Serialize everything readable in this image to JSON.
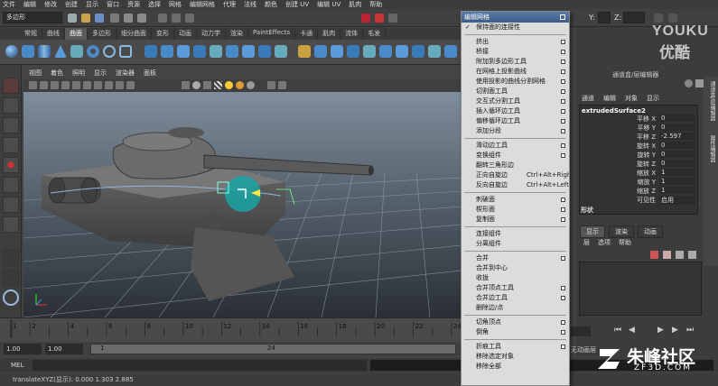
{
  "menubar": [
    "文件",
    "编辑",
    "修改",
    "创建",
    "显示",
    "窗口",
    "资源",
    "选择",
    "网格",
    "编辑网格",
    "代理",
    "法线",
    "颜色",
    "创建 UV",
    "编辑 UV",
    "肌肉",
    "帮助"
  ],
  "status": {
    "mode": "多边形",
    "x_label": "X:",
    "y_label": "Y:",
    "z_label": "Z:"
  },
  "shelf_tabs": [
    "常规",
    "曲线",
    "曲面",
    "多边形",
    "细分曲面",
    "变形",
    "动画",
    "动力学",
    "渲染",
    "PaintEffects",
    "卡通",
    "肌肉",
    "流体",
    "毛发"
  ],
  "shelf_active": "曲面",
  "viewport_menu": [
    "视图",
    "着色",
    "照明",
    "显示",
    "渲染器",
    "面板"
  ],
  "menu": {
    "title": "编辑网格",
    "items": [
      {
        "label": "保持面的连接性",
        "check": "✓",
        "box": false,
        "shortcut": ""
      },
      {
        "sep": true
      },
      {
        "label": "挤出",
        "box": true
      },
      {
        "label": "桥接",
        "box": true
      },
      {
        "label": "附加到多边形工具",
        "box": true
      },
      {
        "label": "在网格上投影曲线",
        "box": true
      },
      {
        "label": "使用投影的曲线分割网格",
        "box": true
      },
      {
        "label": "切割面工具",
        "box": true
      },
      {
        "label": "交互式分割工具",
        "box": true
      },
      {
        "label": "插入循环边工具",
        "box": true
      },
      {
        "label": "偏移循环边工具",
        "box": true
      },
      {
        "label": "添加分段",
        "box": true
      },
      {
        "sep": true
      },
      {
        "label": "滑动边工具",
        "box": true
      },
      {
        "label": "变换组件",
        "box": true
      },
      {
        "label": "翻转三角形边",
        "box": false
      },
      {
        "label": "正向自旋边",
        "box": false,
        "shortcut": "Ctrl+Alt+Right"
      },
      {
        "label": "反向自旋边",
        "box": false,
        "shortcut": "Ctrl+Alt+Left"
      },
      {
        "sep": true
      },
      {
        "label": "刺破面",
        "box": true
      },
      {
        "label": "楔形面",
        "box": true
      },
      {
        "label": "复制面",
        "box": true
      },
      {
        "sep": true
      },
      {
        "label": "连接组件",
        "box": false
      },
      {
        "label": "分离组件",
        "box": false
      },
      {
        "sep": true
      },
      {
        "label": "合并",
        "box": true
      },
      {
        "label": "合并到中心",
        "box": false
      },
      {
        "label": "收拢",
        "box": false
      },
      {
        "label": "合并顶点工具",
        "box": true
      },
      {
        "label": "合并边工具",
        "box": true
      },
      {
        "label": "删除边/点",
        "box": false
      },
      {
        "sep": true
      },
      {
        "label": "切角顶点",
        "box": true
      },
      {
        "label": "倒角",
        "box": true
      },
      {
        "sep": true
      },
      {
        "label": "折痕工具",
        "box": true
      },
      {
        "label": "移除选定对象",
        "box": false
      },
      {
        "label": "移除全部",
        "box": false
      }
    ]
  },
  "channel_box": {
    "header": "通道盒/层编辑器",
    "tabs": [
      "通道",
      "编辑",
      "对象",
      "显示"
    ],
    "object": "extrudedSurface2",
    "attrs": [
      {
        "name": "平移 X",
        "value": "0"
      },
      {
        "name": "平移 Y",
        "value": "0"
      },
      {
        "name": "平移 Z",
        "value": "-2.597"
      },
      {
        "name": "旋转 X",
        "value": "0"
      },
      {
        "name": "旋转 Y",
        "value": "0"
      },
      {
        "name": "旋转 Z",
        "value": "0"
      },
      {
        "name": "缩放 X",
        "value": "1"
      },
      {
        "name": "缩放 Y",
        "value": "1"
      },
      {
        "name": "缩放 Z",
        "value": "1"
      },
      {
        "name": "可见性",
        "value": "启用"
      }
    ],
    "shapes_label": "形状",
    "layer_tabs": [
      "显示",
      "渲染",
      "动画"
    ],
    "layer_menu": [
      "层",
      "选项",
      "帮助"
    ]
  },
  "side_tabs": [
    "通道盒/层编辑器",
    "属性编辑器"
  ],
  "timeline": {
    "ticks": [
      "1",
      "2",
      "4",
      "6",
      "8",
      "10",
      "12",
      "14",
      "16",
      "18",
      "20",
      "22",
      "24"
    ]
  },
  "range": {
    "start": "1.00",
    "start2": "1.00",
    "current": "1",
    "end": "24"
  },
  "mel_label": "MEL",
  "help_text": "translateXYZ(显示):   0.000      1.303      2.885",
  "anim_pref": "无动画层",
  "watermark": {
    "youku_en": "YOUKU",
    "youku_cn": "优酷",
    "site_cn": "朱峰社区",
    "site_url": "ZF3D.COM"
  }
}
